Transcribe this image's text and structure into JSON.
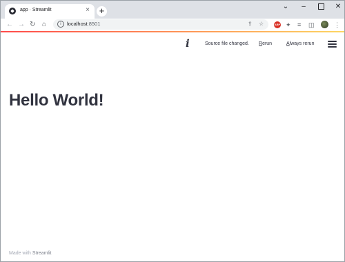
{
  "browser": {
    "tab": {
      "title": "app · Streamlit",
      "close": "×"
    },
    "new_tab": "+",
    "window_controls": {
      "dropdown": "⌄",
      "minimize": "–",
      "close": "✕"
    },
    "nav": {
      "back": "←",
      "forward": "→",
      "reload": "↻",
      "home": "⌂"
    },
    "address": {
      "host": "localhost",
      "port": ":8501",
      "info_glyph": "i"
    },
    "omnibox_icons": {
      "share": "⇪",
      "star": "☆"
    },
    "extensions": {
      "adblock": "ABP",
      "puzzle": "✦",
      "media": "≡",
      "sidepanel": "◫",
      "menu": "⋮"
    },
    "accent_colors": [
      "#ff4b4b",
      "#fdd663"
    ]
  },
  "header": {
    "info_glyph": "i",
    "status": "Source file changed.",
    "rerun_prefix": "R",
    "rerun_rest": "erun",
    "always_prefix": "A",
    "always_rest": "lways rerun"
  },
  "main": {
    "heading": "Hello World!"
  },
  "footer": {
    "made_with": "Made with ",
    "brand": "Streamlit"
  },
  "colors": {
    "text": "#31333f",
    "footer": "#a3a8b4"
  }
}
